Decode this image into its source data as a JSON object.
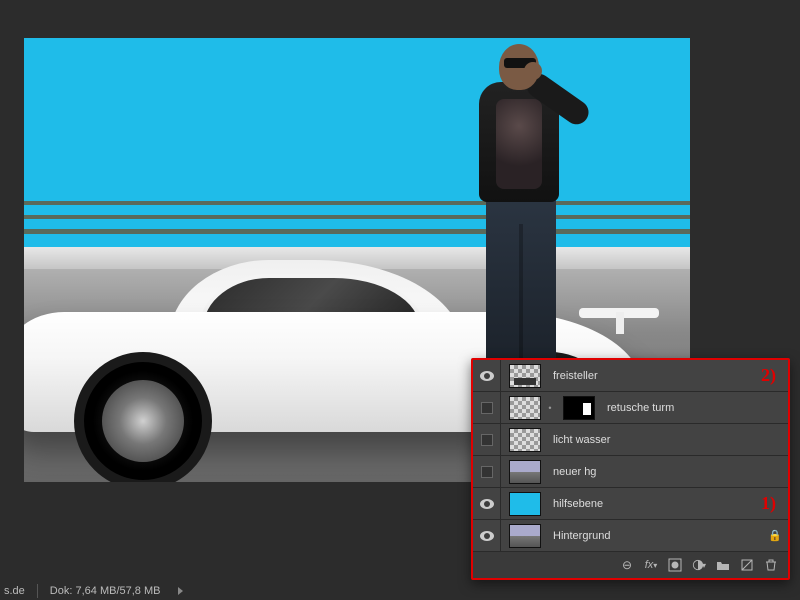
{
  "canvas": {
    "background_color": "#1fbce9",
    "description": "Man standing next to white sports car on cyan background"
  },
  "layers_panel": {
    "annotation_border_color": "#e00000",
    "rows": [
      {
        "visible": true,
        "name": "freisteller",
        "thumb": "checker-sil",
        "annot": "2)",
        "locked": false,
        "has_mask": false
      },
      {
        "visible": false,
        "name": "retusche turm",
        "thumb": "checker",
        "annot": "",
        "locked": false,
        "has_mask": true
      },
      {
        "visible": false,
        "name": "licht wasser",
        "thumb": "checker",
        "annot": "",
        "locked": false,
        "has_mask": false
      },
      {
        "visible": false,
        "name": "neuer hg",
        "thumb": "photo",
        "annot": "",
        "locked": false,
        "has_mask": false
      },
      {
        "visible": true,
        "name": "hilfsebene",
        "thumb": "cyan",
        "annot": "1)",
        "locked": false,
        "has_mask": false
      },
      {
        "visible": true,
        "name": "Hintergrund",
        "thumb": "photo",
        "annot": "",
        "locked": true,
        "has_mask": false
      }
    ],
    "footer_icons": [
      "link",
      "fx",
      "mask",
      "adjustment",
      "group",
      "new-layer",
      "trash"
    ]
  },
  "statusbar": {
    "left_fragment": "s.de",
    "doc_label": "Dok:",
    "doc_size": "7,64 MB/57,8 MB"
  },
  "icons": {
    "lock": "🔒",
    "fx_label": "fx",
    "link_glyph": "⊖"
  }
}
